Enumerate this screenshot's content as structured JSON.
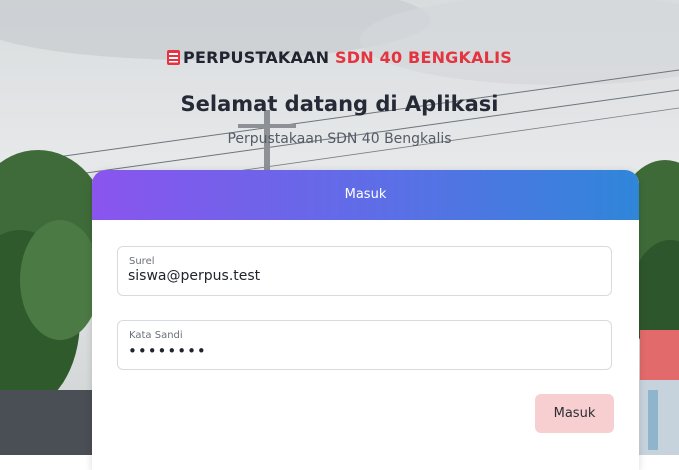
{
  "brand": {
    "icon": "book-icon",
    "name_part1": "PERPUSTAKAAN",
    "name_part2": "SDN 40 BENGKALIS",
    "accent_color": "#e3343f"
  },
  "welcome": {
    "title": "Selamat datang di Aplikasi",
    "subtitle": "Perpustakaan SDN 40 Bengkalis"
  },
  "login_card": {
    "header_title": "Masuk",
    "email": {
      "label": "Surel",
      "value": "siswa@perpus.test"
    },
    "password": {
      "label": "Kata Sandi",
      "value": "••••••••"
    },
    "submit_label": "Masuk"
  },
  "colors": {
    "header_gradient_start": "#8a54ee",
    "header_gradient_end": "#2f86d9",
    "button_bg": "#f7cfd0"
  }
}
